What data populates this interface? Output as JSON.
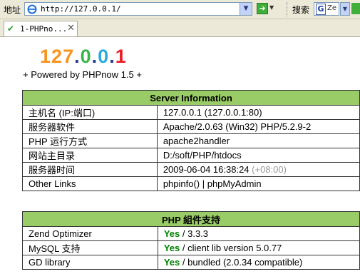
{
  "browser": {
    "address_label": "地址",
    "url": "http://127.0.0.1/",
    "search_label": "搜索",
    "search_text": "Ze",
    "tab_title": "1-PHPno..."
  },
  "page": {
    "logo": [
      "1",
      "2",
      "7",
      ".",
      "0",
      ".",
      "0",
      ".",
      "1"
    ],
    "logo_colors": [
      "#f7931e",
      "#f7931e",
      "#f7931e",
      "#2b3a8f",
      "#39b54a",
      "#2b3a8f",
      "#29abe2",
      "#2b3a8f",
      "#ed1c24"
    ],
    "powered_by": "+ Powered by PHPnow 1.5 +"
  },
  "server_info": {
    "title": "Server Information",
    "rows": [
      {
        "label": "主机名 (IP:端口)",
        "value": "127.0.0.1 (127.0.0.1:80)"
      },
      {
        "label": "服务器软件",
        "value": "Apache/2.0.63 (Win32) PHP/5.2.9-2"
      },
      {
        "label": "PHP 运行方式",
        "value": "apache2handler"
      },
      {
        "label": "网站主目录",
        "value": "D:/soft/PHP/htdocs"
      },
      {
        "label": "服务器时间",
        "value": "2009-06-04 16:38:24",
        "value_extra": "(+08:00)"
      },
      {
        "label": "Other Links",
        "value": "phpinfo() | phpMyAdmin"
      }
    ]
  },
  "php_components": {
    "title": "PHP 組件支持",
    "rows": [
      {
        "label": "Zend Optimizer",
        "status": "Yes",
        "detail": " / 3.3.3"
      },
      {
        "label": "MySQL 支持",
        "status": "Yes",
        "detail": " / client lib version 5.0.77"
      },
      {
        "label": "GD library",
        "status": "Yes",
        "detail": " / bundled (2.0.34 compatible)"
      }
    ]
  }
}
